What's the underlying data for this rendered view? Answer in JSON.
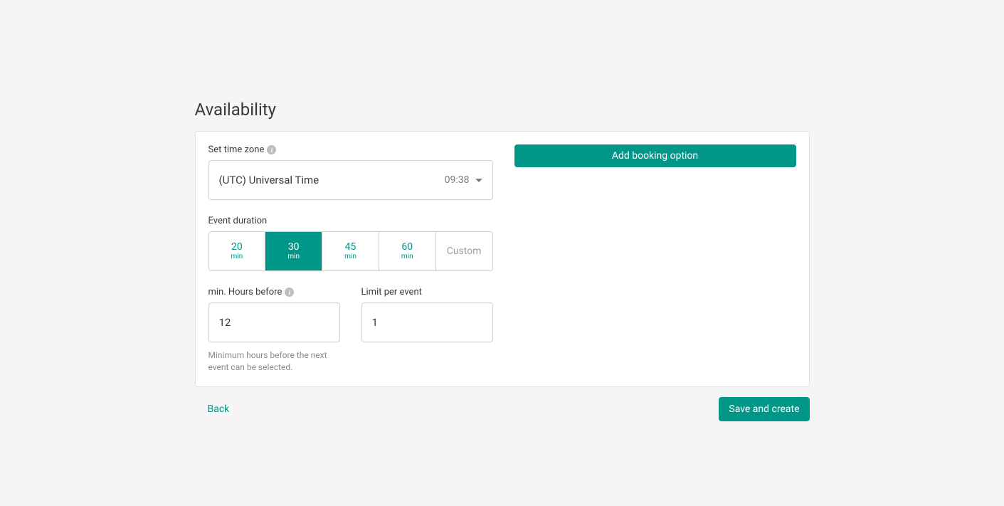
{
  "page_title": "Availability",
  "timezone": {
    "label": "Set time zone",
    "value": "(UTC) Universal Time",
    "time": "09:38"
  },
  "event_duration": {
    "label": "Event duration",
    "options": [
      {
        "value": "20",
        "unit": "min",
        "selected": false
      },
      {
        "value": "30",
        "unit": "min",
        "selected": true
      },
      {
        "value": "45",
        "unit": "min",
        "selected": false
      },
      {
        "value": "60",
        "unit": "min",
        "selected": false
      }
    ],
    "custom_label": "Custom"
  },
  "min_hours_before": {
    "label": "min. Hours before",
    "value": "12",
    "helper": "Minimum hours before the next event can be selected."
  },
  "limit_per_event": {
    "label": "Limit per event",
    "value": "1"
  },
  "add_booking_label": "Add booking option",
  "footer": {
    "back_label": "Back",
    "save_label": "Save and create"
  }
}
